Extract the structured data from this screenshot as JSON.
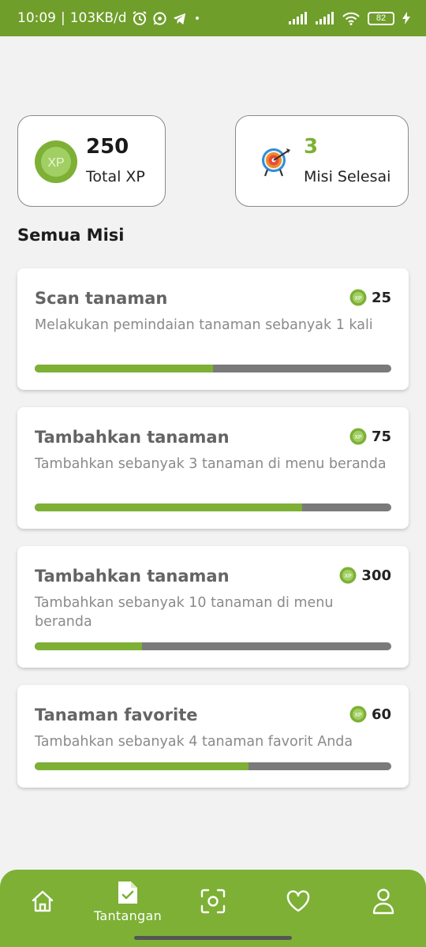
{
  "status_bar": {
    "time": "10:09",
    "speed": "103KB/d",
    "battery": "82",
    "icons": [
      "alarm-icon",
      "whatsapp-icon",
      "telegram-icon",
      "dot-icon",
      "signal-icon",
      "signal-icon",
      "wifi-icon",
      "battery-icon",
      "charging-icon"
    ]
  },
  "stats": {
    "xp_value": "250",
    "xp_label": "Total XP",
    "xp_badge": "XP",
    "missions_value": "3",
    "missions_label": "Misi Selesai"
  },
  "section_title": "Semua Misi",
  "missions": [
    {
      "title": "Scan tanaman",
      "xp": "25",
      "description": "Melakukan pemindaian tanaman sebanyak 1 kali",
      "progress": 0.5
    },
    {
      "title": "Tambahkan tanaman",
      "xp": "75",
      "description": "Tambahkan sebanyak 3 tanaman di menu beranda",
      "progress": 0.75
    },
    {
      "title": "Tambahkan tanaman",
      "xp": "300",
      "description": "Tambahkan sebanyak 10 tanaman di menu beranda",
      "progress": 0.3
    },
    {
      "title": "Tanaman favorite",
      "xp": "60",
      "description": "Tambahkan sebanyak 4 tanaman favorit Anda",
      "progress": 0.6
    }
  ],
  "nav": {
    "active_label": "Tantangan",
    "items": [
      "home-icon",
      "challenge-icon",
      "scan-icon",
      "heart-icon",
      "profile-icon"
    ]
  },
  "colors": {
    "accent": "#7db035",
    "status_bar": "#6f9e2a",
    "track": "#7a7a7a",
    "background": "#f2f2f2"
  }
}
